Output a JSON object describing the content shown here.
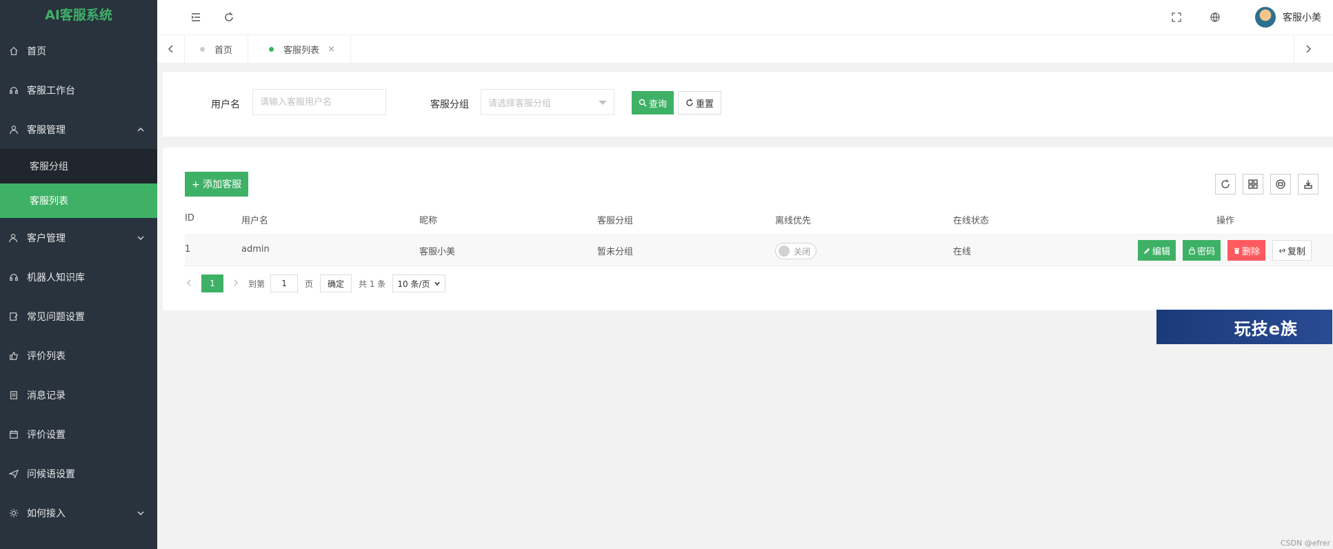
{
  "app": {
    "title": "AI客服系统"
  },
  "sidebar": {
    "items": [
      {
        "label": "首页",
        "icon": "home-icon"
      },
      {
        "label": "客服工作台",
        "icon": "headset-icon"
      },
      {
        "label": "客服管理",
        "icon": "user-icon",
        "expanded": true,
        "children": [
          {
            "label": "客服分组"
          },
          {
            "label": "客服列表",
            "active": true
          }
        ]
      },
      {
        "label": "客户管理",
        "icon": "users-icon",
        "expanded": false
      },
      {
        "label": "机器人知识库",
        "icon": "headset-icon"
      },
      {
        "label": "常见问题设置",
        "icon": "edit-icon"
      },
      {
        "label": "评价列表",
        "icon": "thumbs-up-icon"
      },
      {
        "label": "消息记录",
        "icon": "document-icon"
      },
      {
        "label": "评价设置",
        "icon": "calendar-icon"
      },
      {
        "label": "问候语设置",
        "icon": "send-icon"
      },
      {
        "label": "如何接入",
        "icon": "gear-icon",
        "expanded": false
      }
    ]
  },
  "header": {
    "user_name": "客服小美"
  },
  "tabs": [
    {
      "label": "首页",
      "active": false
    },
    {
      "label": "客服列表",
      "active": true,
      "close": "×"
    }
  ],
  "search": {
    "username_label": "用户名",
    "username_placeholder": "请输入客服用户名",
    "group_label": "客服分组",
    "group_placeholder": "请选择客服分组",
    "query_label": "查询",
    "reset_label": "重置"
  },
  "table": {
    "add_label": "+ 添加客服",
    "columns": [
      "ID",
      "用户名",
      "昵称",
      "客服分组",
      "离线优先",
      "在线状态",
      "操作"
    ],
    "rows": [
      {
        "id": "1",
        "username": "admin",
        "nickname": "客服小美",
        "group": "暂未分组",
        "offline_first": "关闭",
        "status": "在线"
      }
    ],
    "actions": {
      "edit": "编辑",
      "password": "密码",
      "delete": "删除",
      "copy": "复制"
    }
  },
  "pagination": {
    "current": "1",
    "goto_label": "到第",
    "goto_value": "1",
    "page_unit": "页",
    "confirm_label": "确定",
    "total_label": "共 1 条",
    "page_size": "10 条/页"
  },
  "banner": {
    "text": "玩技e族"
  },
  "watermark": "CSDN @efrer",
  "colors": {
    "accent": "#3fb167",
    "sidebar_bg": "#28333e",
    "danger": "#ff5a5f"
  }
}
